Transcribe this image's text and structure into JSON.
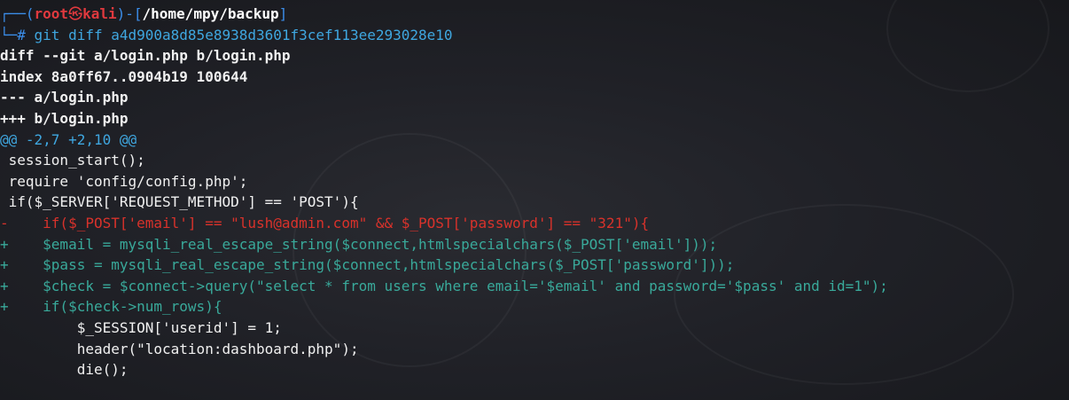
{
  "prompt": {
    "corner_top": "┌──(",
    "user": "root",
    "skull": "㉿",
    "host": "kali",
    "mid": ")-[",
    "path": "/home/mpy/backup",
    "end": "]",
    "corner_bottom": "└─",
    "hash": "# ",
    "command": "git diff a4d900a8d85e8938d3601f3cef113ee293028e10"
  },
  "diff": {
    "header": [
      "diff --git a/login.php b/login.php",
      "index 8a0ff67..0904b19 100644",
      "--- a/login.php",
      "+++ b/login.php"
    ],
    "hunk": "@@ -2,7 +2,10 @@",
    "lines": [
      {
        "type": "context",
        "text": " session_start();"
      },
      {
        "type": "context",
        "text": " require 'config/config.php';"
      },
      {
        "type": "context",
        "text": " if($_SERVER['REQUEST_METHOD'] == 'POST'){"
      },
      {
        "type": "removed",
        "text": "-    if($_POST['email'] == \"lush@admin.com\" && $_POST['password'] == \"321\"){"
      },
      {
        "type": "added",
        "text": "+    $email = mysqli_real_escape_string($connect,htmlspecialchars($_POST['email']));"
      },
      {
        "type": "added",
        "text": "+    $pass = mysqli_real_escape_string($connect,htmlspecialchars($_POST['password']));"
      },
      {
        "type": "added",
        "text": "+    $check = $connect->query(\"select * from users where email='$email' and password='$pass' and id=1\");"
      },
      {
        "type": "added",
        "text": "+    if($check->num_rows){"
      },
      {
        "type": "context",
        "text": "         $_SESSION['userid'] = 1;"
      },
      {
        "type": "context",
        "text": "         header(\"location:dashboard.php\");"
      },
      {
        "type": "context",
        "text": "         die();"
      }
    ]
  },
  "colors": {
    "background": "#1b1c22",
    "prompt_blue": "#3b8eea",
    "prompt_red": "#e0393e",
    "removed": "#d8322b",
    "added": "#39a99a",
    "hunk": "#3fa7e0"
  }
}
